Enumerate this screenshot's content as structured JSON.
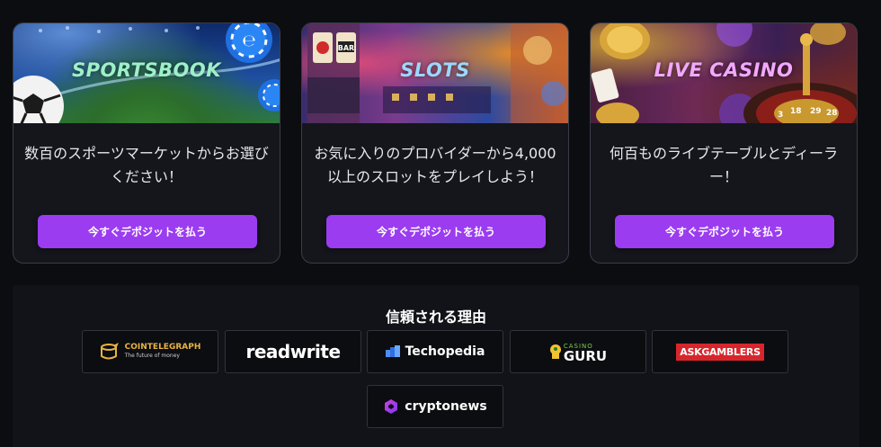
{
  "cards": [
    {
      "banner_title": "SPORTSBOOK",
      "description": "数百のスポーツマーケットからお選びください！",
      "cta_label": "今すぐデポジットを払う"
    },
    {
      "banner_title": "SLOTS",
      "description": "お気に入りのプロバイダーから4,000以上のスロットをプレイしよう！",
      "cta_label": "今すぐデポジットを払う"
    },
    {
      "banner_title": "LIVE CASINO",
      "description": "何百ものライブテーブルとディーラー！",
      "cta_label": "今すぐデポジットを払う"
    }
  ],
  "trust": {
    "title": "信頼される理由",
    "partners": [
      {
        "name": "COINTELEGRAPH",
        "tagline": "The future of money",
        "icon": "cointelegraph-logo"
      },
      {
        "name": "readwrite",
        "icon": "readwrite-logo"
      },
      {
        "name": "Techopedia",
        "icon": "techopedia-logo"
      },
      {
        "name": "GURU",
        "prefix": "CASINO",
        "icon": "casino-guru-logo"
      },
      {
        "name": "ASKGAMBLERS",
        "icon": "askgamblers-logo"
      },
      {
        "name": "cryptonews",
        "icon": "cryptonews-logo"
      }
    ]
  },
  "colors": {
    "cta": "#9b3cf0",
    "background": "#0c0d11",
    "card_bg": "#14161c",
    "askgamblers_red": "#d7262b"
  }
}
